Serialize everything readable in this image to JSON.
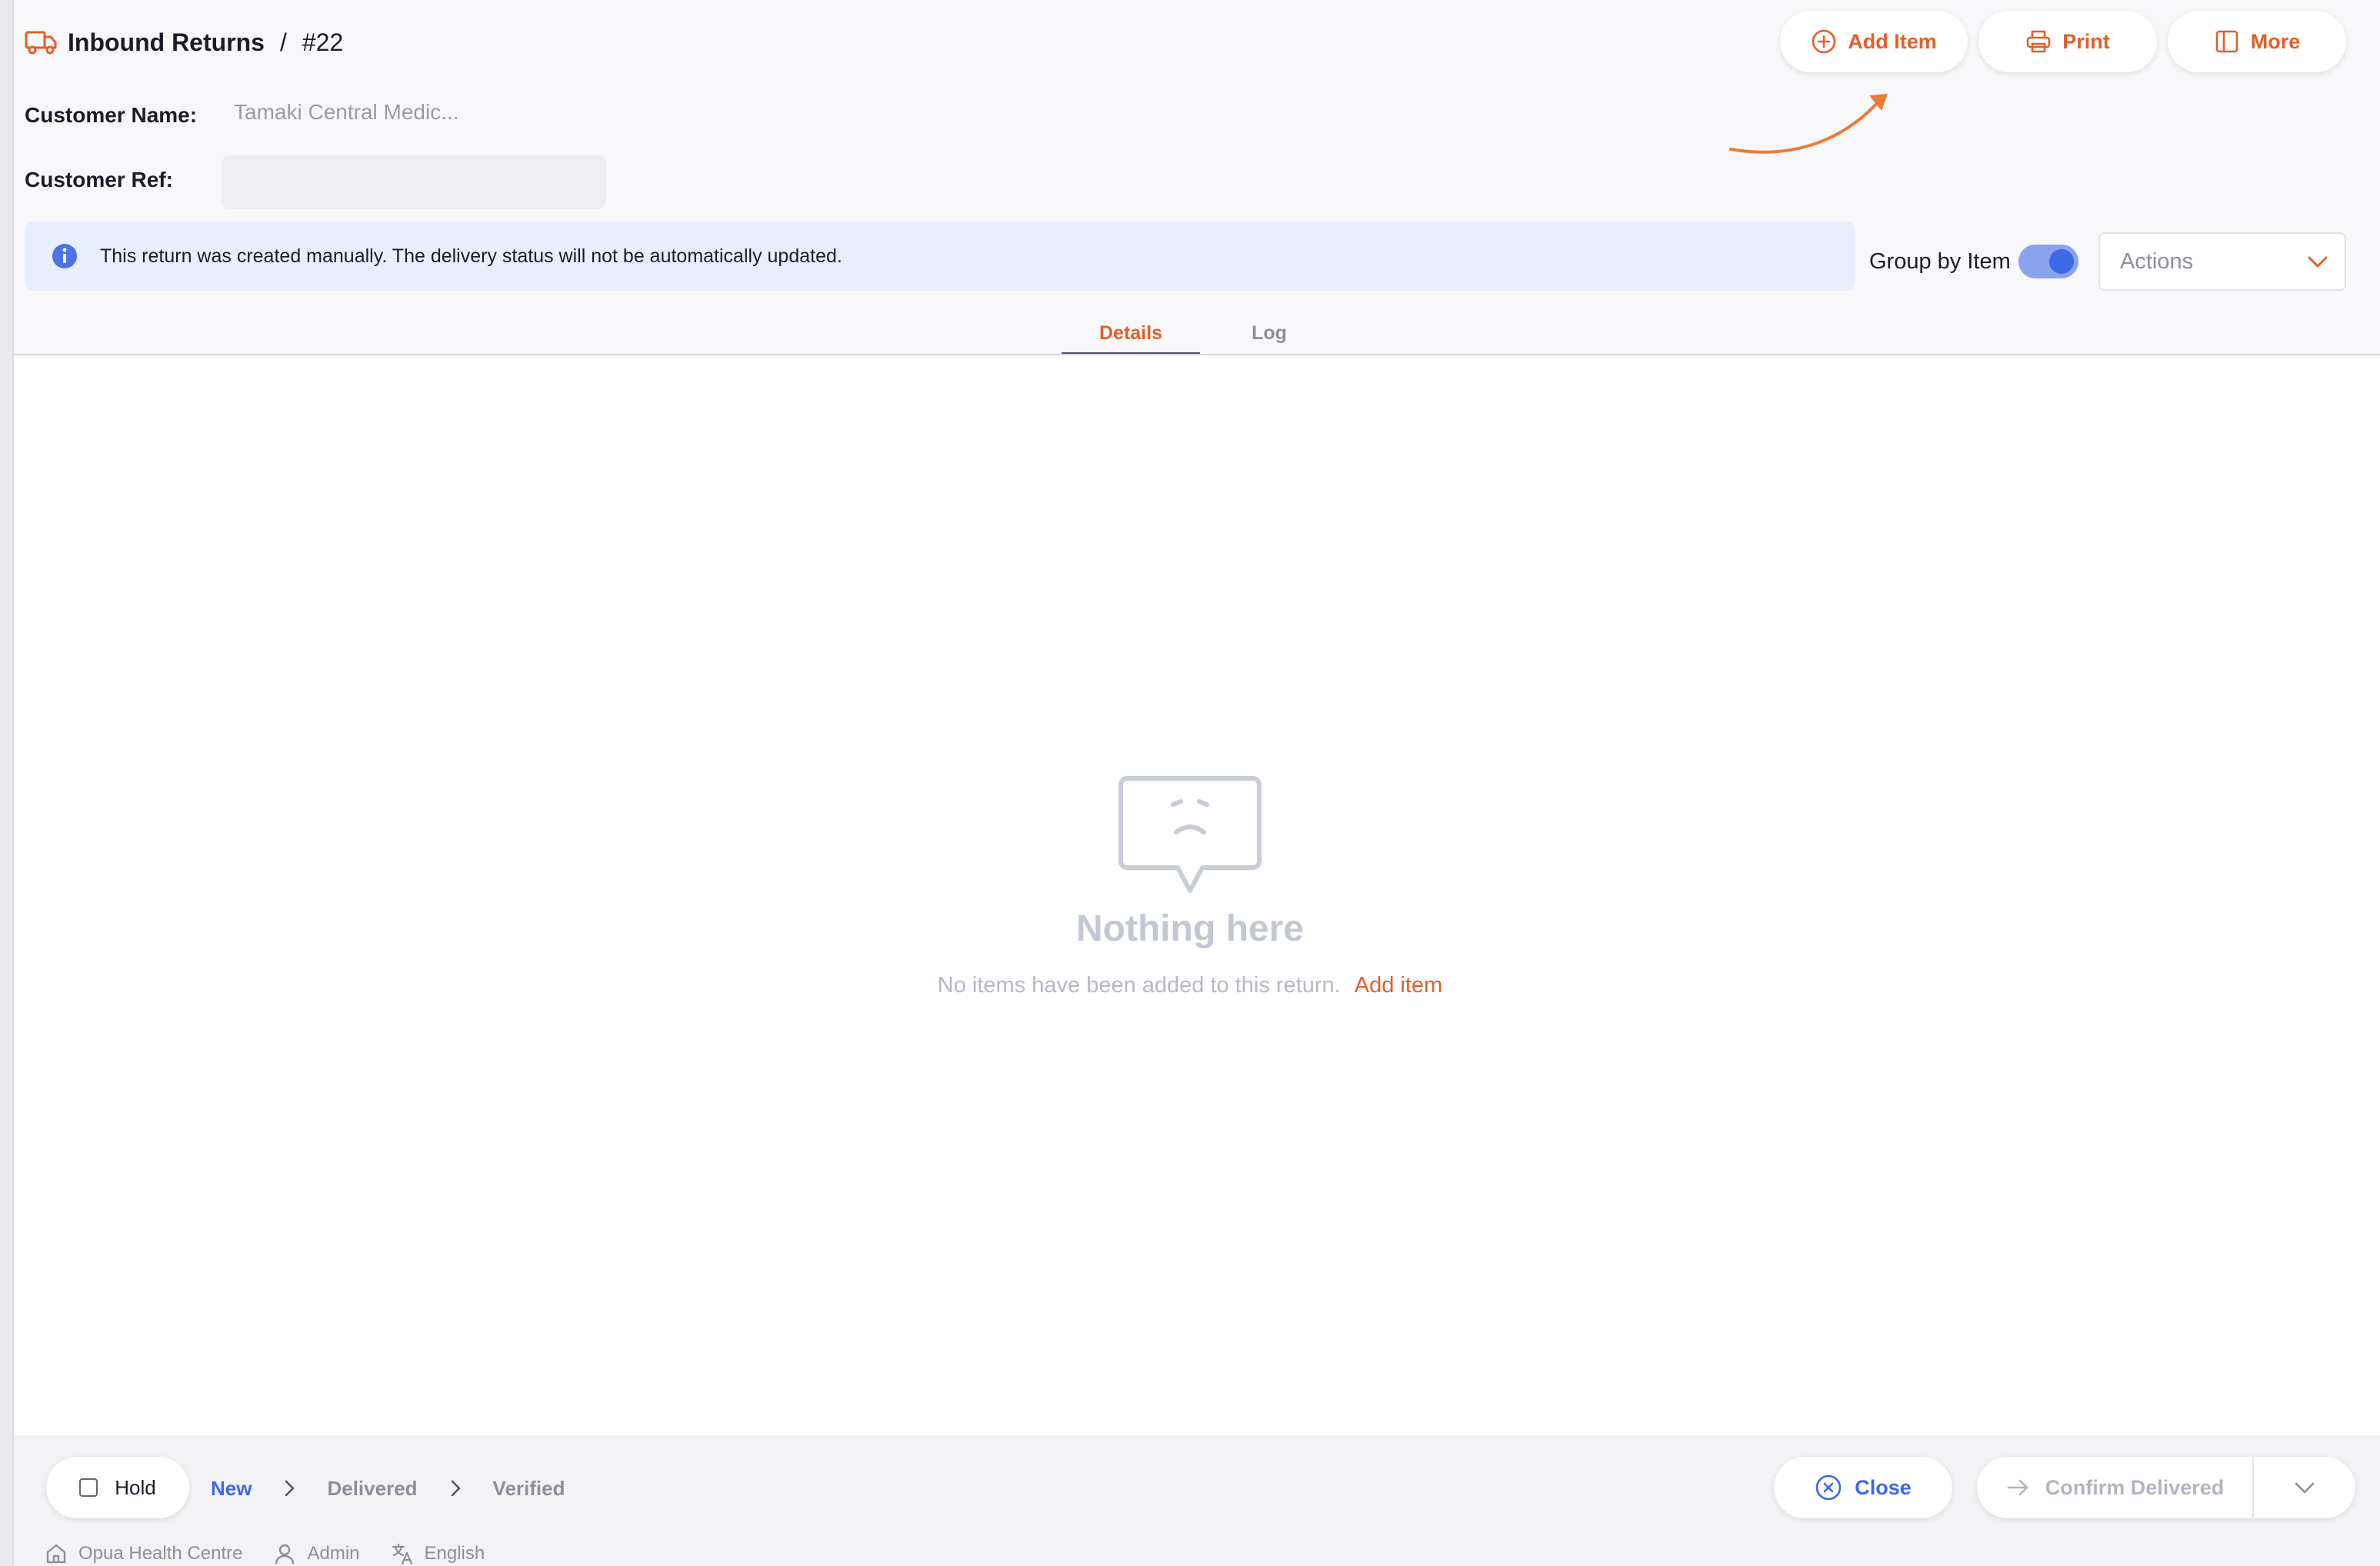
{
  "header": {
    "module": "Inbound Returns",
    "separator": "/",
    "record_number": "#22",
    "icon": "truck-icon"
  },
  "toolbar": {
    "add_item_label": "Add Item",
    "print_label": "Print",
    "more_label": "More"
  },
  "fields": {
    "customer_name_label": "Customer Name:",
    "customer_name_value": "Tamaki Central Medic...",
    "customer_ref_label": "Customer Ref:",
    "customer_ref_value": ""
  },
  "banner": {
    "icon": "info-icon",
    "text": "This return was created manually. The delivery status will not be automatically updated."
  },
  "controls": {
    "group_by_label": "Group by Item",
    "group_by_on": true,
    "actions_placeholder": "Actions"
  },
  "tabs": [
    {
      "label": "Details",
      "active": true
    },
    {
      "label": "Log",
      "active": false
    }
  ],
  "empty_state": {
    "title": "Nothing here",
    "message": "No items have been added to this return.",
    "link": "Add item"
  },
  "footer": {
    "hold_label": "Hold",
    "hold_checked": false,
    "steps": [
      {
        "label": "New",
        "current": true
      },
      {
        "label": "Delivered",
        "current": false
      },
      {
        "label": "Verified",
        "current": false
      }
    ],
    "close_label": "Close",
    "confirm_label": "Confirm Delivered"
  },
  "status_bar": {
    "store": "Opua Health Centre",
    "user": "Admin",
    "language": "English"
  },
  "colors": {
    "accent": "#e0602a",
    "primary": "#3d68e6",
    "banner_bg": "#e9eefb",
    "muted": "#8e8e9a"
  }
}
